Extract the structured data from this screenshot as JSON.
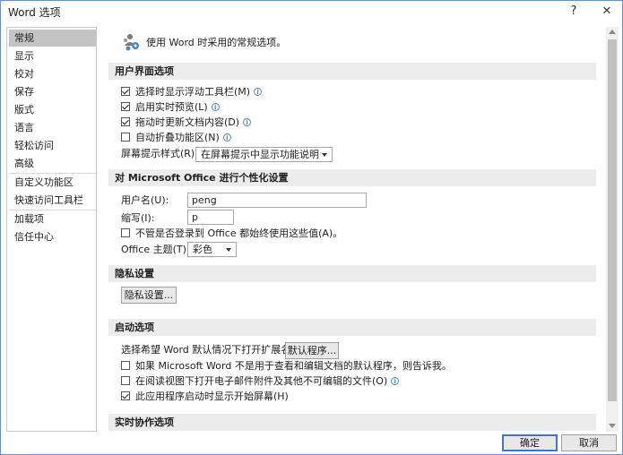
{
  "window": {
    "title": "Word 选项",
    "help_icon": "?",
    "close_icon": "✕"
  },
  "sidebar": {
    "items": [
      {
        "label": "常规"
      },
      {
        "label": "显示"
      },
      {
        "label": "校对"
      },
      {
        "label": "保存"
      },
      {
        "label": "版式"
      },
      {
        "label": "语言"
      },
      {
        "label": "轻松访问"
      },
      {
        "label": "高级"
      },
      {
        "label": "自定义功能区"
      },
      {
        "label": "快速访问工具栏"
      },
      {
        "label": "加载项"
      },
      {
        "label": "信任中心"
      }
    ],
    "active_index": 0
  },
  "intro": {
    "text": "使用 Word 时采用的常规选项。"
  },
  "ui_section": {
    "header": "用户界面选项",
    "checkboxes": [
      {
        "label": "选择时显示浮动工具栏(M)",
        "checked": true,
        "info": true
      },
      {
        "label": "启用实时预览(L)",
        "checked": true,
        "info": true
      },
      {
        "label": "拖动时更新文档内容(D)",
        "checked": true,
        "info": true
      },
      {
        "label": "自动折叠功能区(N)",
        "checked": false,
        "info": true
      }
    ],
    "screentip_label": "屏幕提示样式(R):",
    "screentip_value": "在屏幕提示中显示功能说明"
  },
  "personalize_section": {
    "header": "对 Microsoft Office 进行个性化设置",
    "username_label": "用户名(U):",
    "username_value": "peng",
    "initials_label": "缩写(I):",
    "initials_value": "p",
    "always_use_label": "不管是否登录到 Office 都始终使用这些值(A)。",
    "always_use_checked": false,
    "theme_label": "Office 主题(T):",
    "theme_value": "彩色"
  },
  "privacy_section": {
    "header": "隐私设置",
    "button_label": "隐私设置..."
  },
  "startup_section": {
    "header": "启动选项",
    "default_programs_label": "选择希望 Word 默认情况下打开扩展名:",
    "default_programs_button": "默认程序...",
    "checkboxes": [
      {
        "label": "如果 Microsoft Word 不是用于查看和编辑文档的默认程序，则告诉我。",
        "checked": false,
        "info": false
      },
      {
        "label": "在阅读视图下打开电子邮件附件及其他不可编辑的文件(O)",
        "checked": false,
        "info": true
      },
      {
        "label": "此应用程序启动时显示开始屏幕(H)",
        "checked": true,
        "info": false
      }
    ]
  },
  "coauthor_section": {
    "header": "实时协作选项"
  },
  "footer": {
    "ok_label": "确定",
    "cancel_label": "取消"
  },
  "colors": {
    "accent": "#3a78c8",
    "section_bg": "#ececec",
    "active_nav": "#c4c4c4"
  }
}
